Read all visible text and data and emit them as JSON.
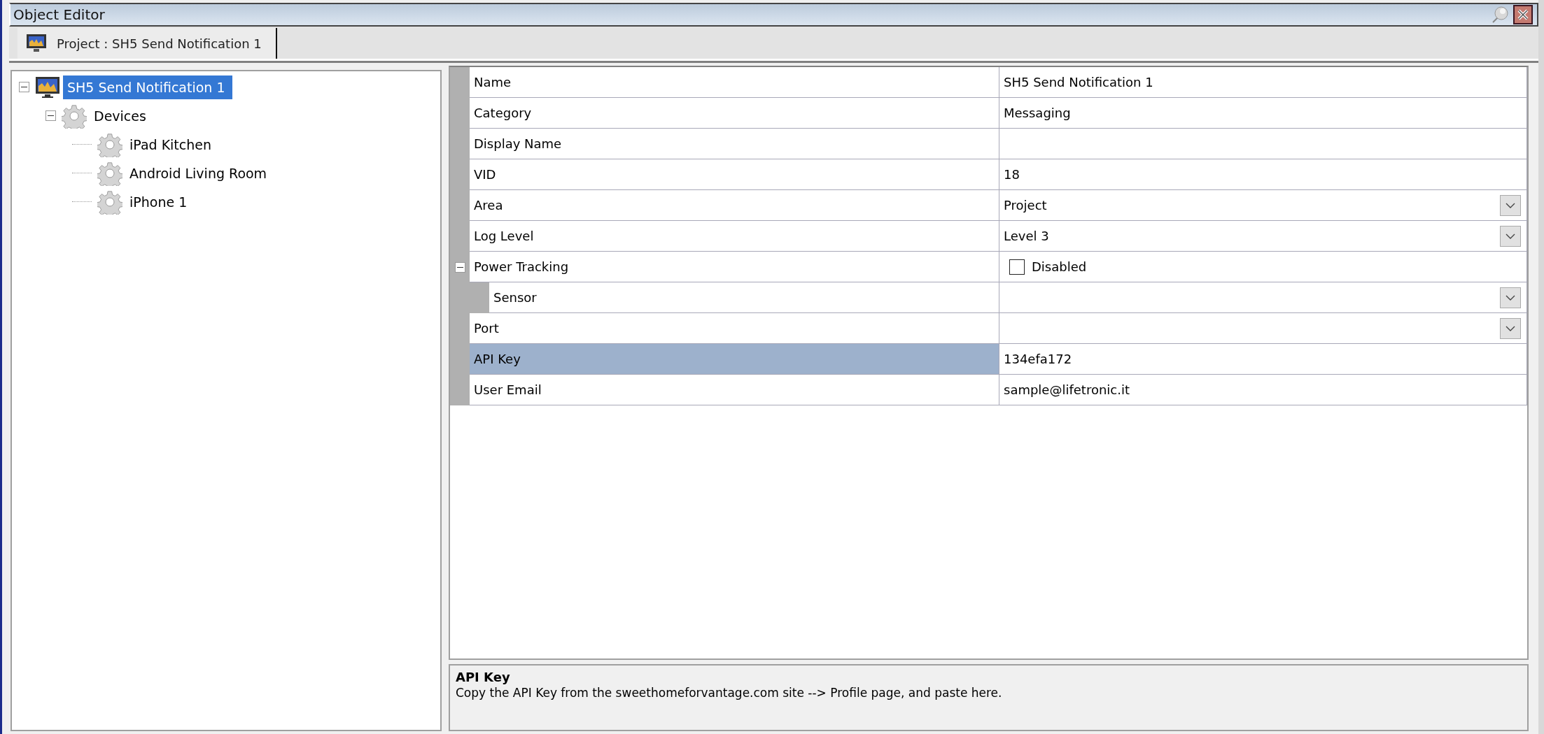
{
  "window": {
    "title": "Object Editor"
  },
  "tabs": [
    {
      "label": "Project : SH5 Send Notification 1",
      "selected": true
    }
  ],
  "tree": [
    {
      "label": "SH5 Send Notification 1",
      "kind": "monitor",
      "selected": true,
      "expanded": true,
      "children": [
        {
          "label": "Devices",
          "kind": "gear",
          "selected": false,
          "expanded": true,
          "children": [
            {
              "label": "iPad Kitchen",
              "kind": "gear",
              "selected": false
            },
            {
              "label": "Android Living Room",
              "kind": "gear",
              "selected": false
            },
            {
              "label": "iPhone 1",
              "kind": "gear",
              "selected": false
            }
          ]
        }
      ]
    }
  ],
  "properties": [
    {
      "name": "Name",
      "kind": "text",
      "value": "SH5 Send Notification 1",
      "selected": false
    },
    {
      "name": "Category",
      "kind": "text",
      "value": "Messaging",
      "selected": false
    },
    {
      "name": "Display Name",
      "kind": "text",
      "selected": false
    },
    {
      "name": "VID",
      "kind": "text",
      "value": "18",
      "selected": false
    },
    {
      "name": "Area",
      "kind": "dropdown",
      "value": "Project",
      "selected": false
    },
    {
      "name": "Log Level",
      "kind": "dropdown",
      "value": "Level 3",
      "selected": false
    },
    {
      "name": "Power Tracking",
      "kind": "checkbox",
      "value": "Disabled",
      "checked": false,
      "selected": false,
      "expanded": true,
      "children": [
        {
          "name": "Sensor",
          "kind": "dropdown",
          "selected": false
        }
      ]
    },
    {
      "name": "Port",
      "kind": "dropdown",
      "selected": false
    },
    {
      "name": "API Key",
      "kind": "text",
      "value": "134efa172",
      "selected": true
    },
    {
      "name": "User Email",
      "kind": "text",
      "value": "sample@lifetronic.it",
      "selected": false
    }
  ],
  "description": {
    "title": "API Key",
    "text": "Copy the API Key from the sweethomeforvantage.com site --> Profile page, and paste here."
  }
}
